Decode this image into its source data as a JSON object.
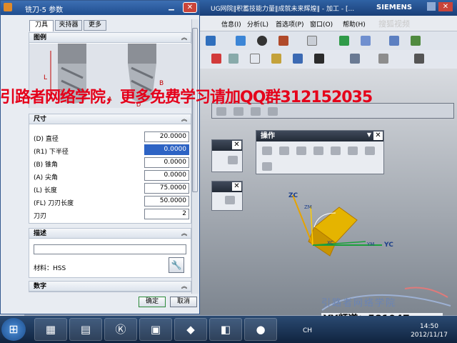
{
  "nx": {
    "title": "UG网院‖积蓄技能力量‖成就未来辉煌‖ - 加工 - [...",
    "brand": "SIEMENS",
    "menu": [
      "信息(I)",
      "分析(L)",
      "首选项(P)",
      "窗口(O)",
      "帮助(H)"
    ],
    "wm_logo": "搜狐视频"
  },
  "dialog": {
    "title": "铣刀-5 参数",
    "tabs": [
      "刀具",
      "夹持器",
      "更多"
    ],
    "sections": {
      "figure": "图例",
      "dimensions": "尺寸",
      "description": "描述",
      "numbering": "数字"
    },
    "figure_labels": {
      "length": "L",
      "fl": "FL",
      "d": "D",
      "b": "B",
      "a": "A"
    },
    "fields": [
      {
        "label": "(D) 直径",
        "value": "20.0000"
      },
      {
        "label": "(R1) 下半径",
        "value": "0.0000"
      },
      {
        "label": "(B) 锥角",
        "value": "0.0000"
      },
      {
        "label": "(A) 尖角",
        "value": "0.0000"
      },
      {
        "label": "(L) 长度",
        "value": "75.0000"
      },
      {
        "label": "(FL) 刀刃长度",
        "value": "50.0000"
      },
      {
        "label": "刀刃",
        "value": "2"
      }
    ],
    "description_value": "",
    "material": "材料：HSS",
    "ok": "确定",
    "cancel": "取消"
  },
  "palettes": {
    "operation": "操作"
  },
  "watermark": "引路者网络学院，更多免费学习请加QQ群312152035",
  "triad": {
    "zc": "ZC",
    "zm": "ZM",
    "ym": "YM",
    "yc": "YC",
    "xc": "XC"
  },
  "stamp": {
    "title": "引路者网络学院",
    "yy": "YY频道：581947"
  },
  "taskbar": {
    "lang": "CH",
    "time": "14:50",
    "date": "2012/11/17"
  },
  "colors": {
    "accent": "#2d63c4",
    "watermark": "#e5001a",
    "stamp": "#6a84b5"
  }
}
